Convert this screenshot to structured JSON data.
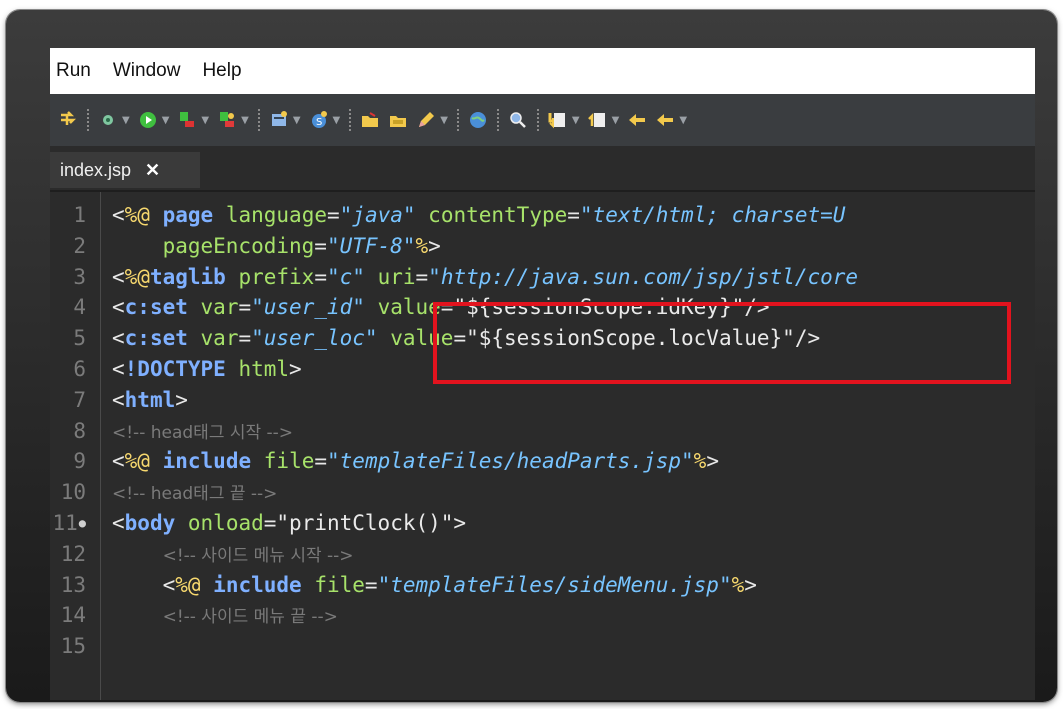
{
  "menu": {
    "items": [
      "Run",
      "Window",
      "Help"
    ]
  },
  "toolbar": {
    "icons": [
      "step-into-icon",
      "debug-config-icon",
      "run-icon",
      "external-tools-icon",
      "coverage-icon",
      "new-server-icon",
      "new-class-icon",
      "open-folder-icon",
      "open-folder2-icon",
      "pencil-icon",
      "globe-icon",
      "search-tools-icon",
      "next-annotation-icon",
      "prev-annotation-icon",
      "back-icon",
      "forward-icon"
    ]
  },
  "tab": {
    "label": "index.jsp",
    "close": "✕"
  },
  "editor": {
    "line_numbers": [
      "1",
      "2",
      "3",
      "4",
      "5",
      "6",
      "7",
      "8",
      "9",
      "10",
      "11",
      "12",
      "13",
      "14",
      "15"
    ],
    "lines": [
      [
        [
          "d",
          "<"
        ],
        [
          "pct",
          "%@"
        ],
        [
          "d",
          " "
        ],
        [
          "kw",
          "page"
        ],
        [
          "d",
          " "
        ],
        [
          "at",
          "language"
        ],
        [
          "d",
          "="
        ],
        [
          "st",
          "\"java\""
        ],
        [
          "d",
          " "
        ],
        [
          "at",
          "contentType"
        ],
        [
          "d",
          "="
        ],
        [
          "st",
          "\"text/html; charset=U"
        ]
      ],
      [
        [
          "d",
          "    "
        ],
        [
          "at",
          "pageEncoding"
        ],
        [
          "d",
          "="
        ],
        [
          "st",
          "\"UTF-8\""
        ],
        [
          "pct",
          "%"
        ],
        [
          "d",
          ">"
        ]
      ],
      [
        [
          "d",
          "<"
        ],
        [
          "pct",
          "%@"
        ],
        [
          "kw",
          "taglib"
        ],
        [
          "d",
          " "
        ],
        [
          "at",
          "prefix"
        ],
        [
          "d",
          "="
        ],
        [
          "st",
          "\"c\""
        ],
        [
          "d",
          " "
        ],
        [
          "at",
          "uri"
        ],
        [
          "d",
          "="
        ],
        [
          "st",
          "\"http://java.sun.com/jsp/jstl/core"
        ]
      ],
      [
        [
          "d",
          "<"
        ],
        [
          "tg",
          "c:set"
        ],
        [
          "d",
          " "
        ],
        [
          "at",
          "var"
        ],
        [
          "d",
          "="
        ],
        [
          "st",
          "\"user_id\""
        ],
        [
          "d",
          " "
        ],
        [
          "at",
          "value"
        ],
        [
          "d",
          "="
        ],
        [
          "sn",
          "\"${sessionScope.idKey}\""
        ],
        [
          "d",
          "/>"
        ]
      ],
      [
        [
          "d",
          "<"
        ],
        [
          "tg",
          "c:set"
        ],
        [
          "d",
          " "
        ],
        [
          "at",
          "var"
        ],
        [
          "d",
          "="
        ],
        [
          "st",
          "\"user_loc\""
        ],
        [
          "d",
          " "
        ],
        [
          "at",
          "value"
        ],
        [
          "d",
          "="
        ],
        [
          "sn",
          "\"${sessionScope.locValue}\""
        ],
        [
          "d",
          "/>"
        ]
      ],
      [
        [
          "d",
          "<"
        ],
        [
          "tg",
          "!DOCTYPE"
        ],
        [
          "d",
          " "
        ],
        [
          "at",
          "html"
        ],
        [
          "d",
          ">"
        ]
      ],
      [
        [
          "d",
          "<"
        ],
        [
          "tg",
          "html"
        ],
        [
          "d",
          ">"
        ]
      ],
      [
        [
          "cm",
          "<!-- head태그 시작 -->"
        ]
      ],
      [
        [
          "d",
          "<"
        ],
        [
          "pct",
          "%@"
        ],
        [
          "d",
          " "
        ],
        [
          "kw",
          "include"
        ],
        [
          "d",
          " "
        ],
        [
          "at",
          "file"
        ],
        [
          "d",
          "="
        ],
        [
          "st",
          "\"templateFiles/headParts.jsp\""
        ],
        [
          "pct",
          "%"
        ],
        [
          "d",
          ">"
        ]
      ],
      [
        [
          "cm",
          "<!-- head태그 끝 -->"
        ]
      ],
      [
        [
          "d",
          "<"
        ],
        [
          "tg",
          "body"
        ],
        [
          "d",
          " "
        ],
        [
          "at",
          "onload"
        ],
        [
          "d",
          "="
        ],
        [
          "sn",
          "\"printClock()\""
        ],
        [
          "d",
          ">"
        ]
      ],
      [
        [
          "d",
          "    "
        ],
        [
          "cm",
          "<!-- 사이드 메뉴 시작 -->"
        ]
      ],
      [
        [
          "d",
          "    <"
        ],
        [
          "pct",
          "%@"
        ],
        [
          "d",
          " "
        ],
        [
          "kw",
          "include"
        ],
        [
          "d",
          " "
        ],
        [
          "at",
          "file"
        ],
        [
          "d",
          "="
        ],
        [
          "st",
          "\"templateFiles/sideMenu.jsp\""
        ],
        [
          "pct",
          "%"
        ],
        [
          "d",
          ">"
        ]
      ],
      [
        [
          "d",
          "    "
        ],
        [
          "cm",
          "<!-- 사이드 메뉴 끝 -->"
        ]
      ],
      []
    ]
  },
  "colors": {
    "highlight_box": "#e2131e",
    "editor_bg": "#2b2b2b",
    "keyword": "#7fb0ff",
    "attribute": "#a7e26a",
    "string": "#78c4ff",
    "directive": "#f7d86e",
    "comment": "#7a7a7a"
  }
}
